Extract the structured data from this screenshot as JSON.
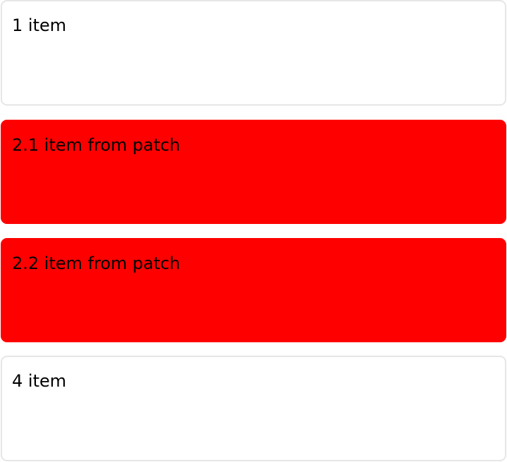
{
  "items": [
    {
      "label": "1 item",
      "background": "#ffffff"
    },
    {
      "label": "2.1 item from patch",
      "background": "#ff0000"
    },
    {
      "label": "2.2 item from patch",
      "background": "#ff0000"
    },
    {
      "label": "4 item",
      "background": "#ffffff"
    }
  ],
  "colors": {
    "card_border": "#e6e6e6",
    "patch_highlight": "#ff0000",
    "text": "#000000"
  }
}
